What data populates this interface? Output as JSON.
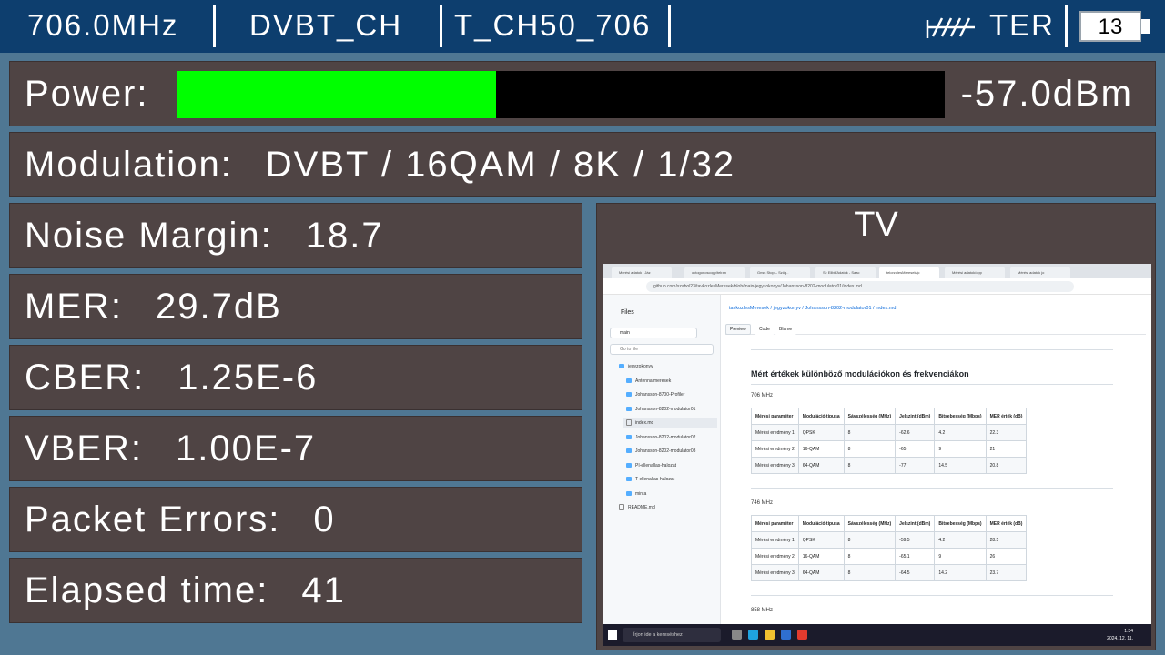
{
  "header": {
    "frequency": "706.0MHz",
    "channel_table": "DVBT_CH",
    "channel": "T_CH50_706",
    "band": "TER",
    "battery": "13",
    "antenna_icon": "antenna-icon"
  },
  "power": {
    "label": "Power:",
    "value": "-57.0dBm",
    "level_fraction": 0.416,
    "fill_color": "#00ff00"
  },
  "modulation": {
    "label": "Modulation:",
    "value": "DVBT / 16QAM / 8K / 1/32"
  },
  "noise_margin": {
    "label": "Noise Margin:",
    "value": "18.7"
  },
  "mer": {
    "label": "MER:",
    "value": "29.7dB"
  },
  "cber": {
    "label": "CBER:",
    "value": "1.25E-6"
  },
  "vber": {
    "label": "VBER:",
    "value": "1.00E-7"
  },
  "packet_errors": {
    "label": "Packet Errors:",
    "value": "0"
  },
  "elapsed": {
    "label": "Elapsed time:",
    "value": "41"
  },
  "tv": {
    "title": "TV",
    "browser": {
      "tabs": [
        "Mérési adatok | Jáz",
        "octogonoscopy/telran",
        "Gnss Stop – Szög..",
        "Sz Ellbil/Adatok - Saac",
        "telorzolesMeresek/jc",
        "Mérési adatok/opp",
        "Mérési adatok jo"
      ],
      "address": "github.com/szabol23/tavkozlesMeresek/blob/main/jegyzokonyv/Johansson-8202-modulator01/index.md",
      "files_title": "Files",
      "branch": "main",
      "goto_placeholder": "Go to file",
      "tree": [
        "jegyzokonyv",
        "Antenna meresek",
        "Johansson-8700-Profiler",
        "Johansson-8202-modulator01",
        "index.md",
        "Johansson-8202-modulator02",
        "Johansson-8202-modulator03",
        "PI-ellenallas-halozat",
        "T-ellenallas-halozat",
        "minta",
        "README.md"
      ],
      "breadcrumb": "tavkozlesMeresek / jegyzokonyv / Johansson-8202-modulator01 / index.md",
      "tab_preview": "Preview",
      "tab_code": "Code",
      "tab_blame": "Blame",
      "heading": "Mért értékek különböző modulációkon és frekvenciákon",
      "sections": [
        {
          "title": "706 MHz",
          "headers": [
            "Mérési paraméter",
            "Moduláció típusa",
            "Sávszélesség (MHz)",
            "Jelszint (dBm)",
            "Bitsebesség (Mbps)",
            "MER érték (dB)"
          ],
          "rows": [
            [
              "Mérési eredmény 1",
              "QPSK",
              "8",
              "-62.6",
              "4.2",
              "22.3"
            ],
            [
              "Mérési eredmény 2",
              "16-QAM",
              "8",
              "-65",
              "9",
              "21"
            ],
            [
              "Mérési eredmény 3",
              "64-QAM",
              "8",
              "-77",
              "14.5",
              "20.8"
            ]
          ]
        },
        {
          "title": "746 MHz",
          "headers": [
            "Mérési paraméter",
            "Moduláció típusa",
            "Sávszélesség (MHz)",
            "Jelszint (dBm)",
            "Bitsebesség (Mbps)",
            "MER érték (dB)"
          ],
          "rows": [
            [
              "Mérési eredmény 1",
              "QPSK",
              "8",
              "-59.5",
              "4.2",
              "28.5"
            ],
            [
              "Mérési eredmény 2",
              "16-QAM",
              "8",
              "-65.1",
              "9",
              "26"
            ],
            [
              "Mérési eredmény 3",
              "64-QAM",
              "8",
              "-64.5",
              "14.2",
              "23.7"
            ]
          ]
        }
      ],
      "next_section": "858 MHz",
      "taskbar_search": "Írjon ide a kereséshez",
      "clock_time": "1:34",
      "clock_date": "2024. 12. 11."
    }
  }
}
